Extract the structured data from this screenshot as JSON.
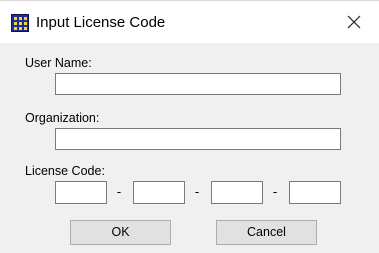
{
  "window": {
    "title": "Input License Code",
    "close_glyph": "X",
    "icon": "license-app-icon"
  },
  "form": {
    "user_name": {
      "label": "User Name:",
      "value": ""
    },
    "organization": {
      "label": "Organization:",
      "value": ""
    },
    "license_code": {
      "label": "License Code:",
      "segments": [
        "",
        "",
        "",
        ""
      ],
      "separator": "-"
    }
  },
  "buttons": {
    "ok_label": "OK",
    "cancel_label": "Cancel"
  },
  "colors": {
    "dialog_background": "#f0f0f0",
    "titlebar_background": "#ffffff",
    "field_border": "#7a7a7a",
    "button_face": "#e1e1e1",
    "button_border": "#adadad",
    "icon_blue": "#1f2f8f",
    "icon_yellow": "#f3d34a"
  }
}
